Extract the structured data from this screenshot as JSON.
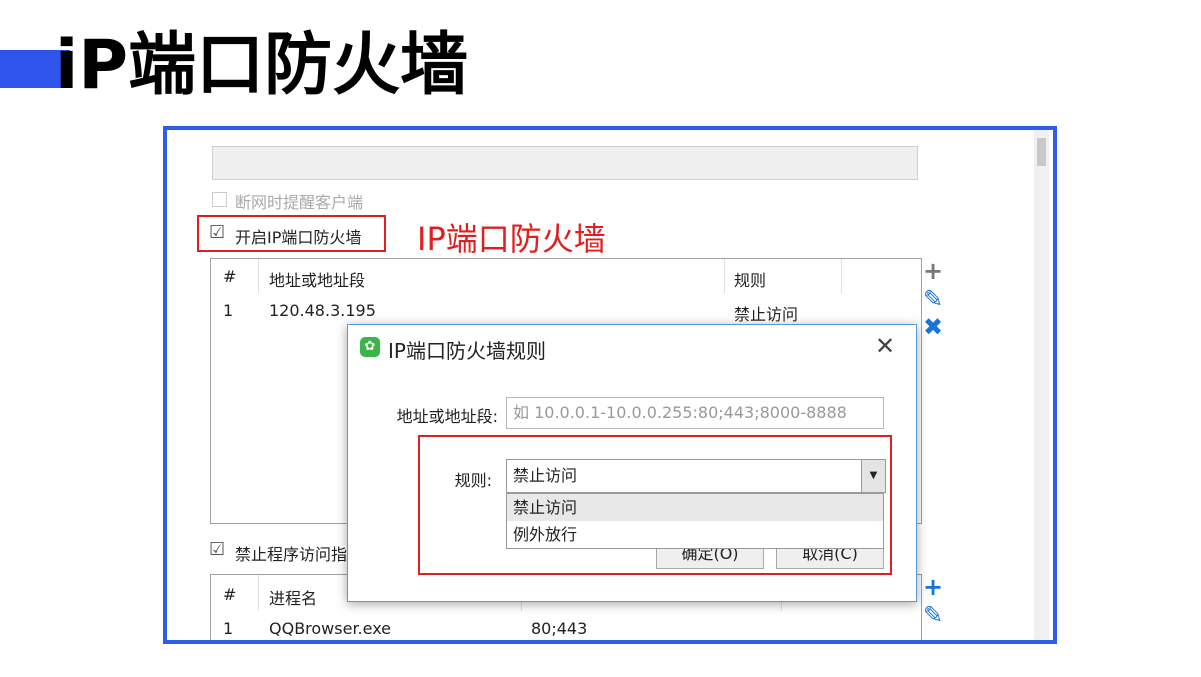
{
  "slide": {
    "title": "iP端口防火墙"
  },
  "settings": {
    "notify_label": "断网时提醒客户端",
    "enable_label": "开启IP端口防火墙",
    "enable_checked_mark": "☑",
    "annotation": "IP端口防火墙",
    "block_program_label": "禁止程序访问指",
    "block_checked_mark": "☑"
  },
  "ip_table": {
    "headers": [
      "#",
      "地址或地址段",
      "规则"
    ],
    "rows": [
      {
        "num": "1",
        "address": "120.48.3.195",
        "rule": "禁止访问"
      }
    ]
  },
  "program_table": {
    "headers": [
      "#",
      "进程名"
    ],
    "rows": [
      {
        "num": "1",
        "process": "QQBrowser.exe",
        "ports": "80;443"
      }
    ]
  },
  "icons": {
    "add": "plus-icon",
    "edit": "pencil-icon",
    "delete": "close-icon"
  },
  "dialog": {
    "title": "IP端口防火墙规则",
    "close_glyph": "✕",
    "address_label": "地址或地址段:",
    "address_placeholder": "如 10.0.0.1-10.0.0.255:80;443;8000-8888",
    "rule_label": "规则:",
    "rule_value": "禁止访问",
    "options": [
      "禁止访问",
      "例外放行"
    ],
    "ok_label": "确定(O)",
    "cancel_label": "取消(C)"
  },
  "colors": {
    "accent": "#2f54eb",
    "frame": "#2f5ce8",
    "highlight": "#e02020",
    "icon_blue": "#1a73d9"
  }
}
